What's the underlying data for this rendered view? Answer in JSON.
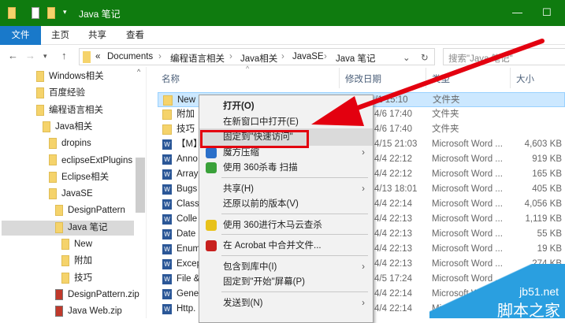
{
  "window": {
    "title": "Java 笔记",
    "minimize": "—",
    "maximize": "☐"
  },
  "ribbon": {
    "tabs": [
      "文件",
      "主页",
      "共享",
      "查看"
    ]
  },
  "address": {
    "prefix": "«",
    "crumbs": [
      "Documents",
      "编程语言相关",
      "Java相关",
      "JavaSE",
      "Java 笔记"
    ],
    "search_placeholder": "搜索\"Java 笔记\""
  },
  "sidebar": {
    "items": [
      {
        "label": "Windows相关",
        "level": 0
      },
      {
        "label": "百度经验",
        "level": 0
      },
      {
        "label": "编程语言相关",
        "level": 0
      },
      {
        "label": "Java相关",
        "level": 1
      },
      {
        "label": "dropins",
        "level": 2
      },
      {
        "label": "eclipseExtPlugins",
        "level": 2
      },
      {
        "label": "Eclipse相关",
        "level": 2
      },
      {
        "label": "JavaSE",
        "level": 2
      },
      {
        "label": "DesignPattern",
        "level": 3
      },
      {
        "label": "Java 笔记",
        "level": 3,
        "selected": true
      },
      {
        "label": "New",
        "level": 4
      },
      {
        "label": "附加",
        "level": 4
      },
      {
        "label": "技巧",
        "level": 4
      },
      {
        "label": "DesignPattern.zip",
        "level": 3,
        "zip": true
      },
      {
        "label": "Java Web.zip",
        "level": 3,
        "zip": true
      }
    ]
  },
  "columns": {
    "name": "名称",
    "date": "修改日期",
    "type": "类型",
    "size": "大小"
  },
  "files": [
    {
      "name": "New",
      "date": "/1 15:10",
      "type": "文件夹",
      "size": "",
      "kind": "folder",
      "selected": true
    },
    {
      "name": "附加",
      "date": "4/6 17:40",
      "type": "文件夹",
      "size": "",
      "kind": "folder"
    },
    {
      "name": "技巧",
      "date": "4/6 17:40",
      "type": "文件夹",
      "size": "",
      "kind": "folder"
    },
    {
      "name": "【M】",
      "date": "4/15 21:03",
      "type": "Microsoft Word ...",
      "size": "4,603 KB",
      "kind": "word"
    },
    {
      "name": "Anno",
      "date": "4/4 22:12",
      "type": "Microsoft Word ...",
      "size": "919 KB",
      "kind": "word"
    },
    {
      "name": "Array",
      "date": "4/4 22:12",
      "type": "Microsoft Word ...",
      "size": "165 KB",
      "kind": "word"
    },
    {
      "name": "Bugs",
      "date": "4/13 18:01",
      "type": "Microsoft Word ...",
      "size": "405 KB",
      "kind": "word"
    },
    {
      "name": "Class",
      "date": "4/4 22:14",
      "type": "Microsoft Word ...",
      "size": "4,056 KB",
      "kind": "word"
    },
    {
      "name": "Colle",
      "date": "4/4 22:13",
      "type": "Microsoft Word ...",
      "size": "1,119 KB",
      "kind": "word"
    },
    {
      "name": "Date",
      "date": "4/4 22:13",
      "type": "Microsoft Word ...",
      "size": "55 KB",
      "kind": "word"
    },
    {
      "name": "Enum",
      "date": "4/4 22:13",
      "type": "Microsoft Word ...",
      "size": "19 KB",
      "kind": "word"
    },
    {
      "name": "Excep",
      "date": "4/4 22:13",
      "type": "Microsoft Word ...",
      "size": "274 KB",
      "kind": "word"
    },
    {
      "name": "File &",
      "date": "4/5 17:24",
      "type": "Microsoft Word ...",
      "size": "",
      "kind": "word"
    },
    {
      "name": "Gene",
      "date": "4/4 22:14",
      "type": "Microsoft Word ...",
      "size": "",
      "kind": "word"
    },
    {
      "name": "Http.",
      "date": "4/4 22:14",
      "type": "Microsoft Word ...",
      "size": "",
      "kind": "word"
    }
  ],
  "context_menu": {
    "items": [
      {
        "label": "打开(O)",
        "bold": true
      },
      {
        "label": "在新窗口中打开(E)"
      },
      {
        "label": "固定到\"快速访问\"",
        "hover": true
      },
      {
        "label": "魔方压缩",
        "icon": "cube-icon",
        "submenu": true
      },
      {
        "label": "使用 360杀毒 扫描",
        "icon": "shield-icon"
      },
      {
        "sep": true
      },
      {
        "label": "共享(H)",
        "submenu": true
      },
      {
        "label": "还原以前的版本(V)"
      },
      {
        "sep": true
      },
      {
        "label": "使用 360进行木马云查杀",
        "icon": "360-scan-icon"
      },
      {
        "sep": true
      },
      {
        "label": "在 Acrobat 中合并文件...",
        "icon": "acrobat-icon"
      },
      {
        "sep": true
      },
      {
        "label": "包含到库中(I)",
        "submenu": true
      },
      {
        "label": "固定到\"开始\"屏幕(P)"
      },
      {
        "sep": true
      },
      {
        "label": "发送到(N)",
        "submenu": true
      }
    ]
  },
  "watermark": {
    "site": "jb51.net",
    "name": "脚本之家"
  },
  "colors": {
    "titlebar": "#0f7b0f",
    "file_tab": "#1979ca",
    "highlight": "#e3000f"
  }
}
